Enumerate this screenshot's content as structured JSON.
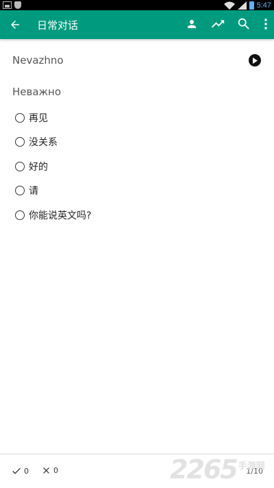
{
  "status_bar": {
    "time": "5:47"
  },
  "app_bar": {
    "title": "日常对话",
    "back_icon": "arrow-back-icon",
    "actions": [
      "person-icon",
      "trending-up-icon",
      "search-icon",
      "more-vert-icon"
    ]
  },
  "card": {
    "transliteration": "Nevazhno",
    "word": "Неважно",
    "options": [
      "再见",
      "没关系",
      "好的",
      "请",
      "你能说英文吗?"
    ]
  },
  "bottom_bar": {
    "correct_count": "0",
    "wrong_count": "0",
    "progress": "1/10"
  },
  "watermark": {
    "number": "2265",
    "text": "手游网"
  },
  "colors": {
    "accent": "#009a7e",
    "status_time": "#5ab3ff"
  }
}
